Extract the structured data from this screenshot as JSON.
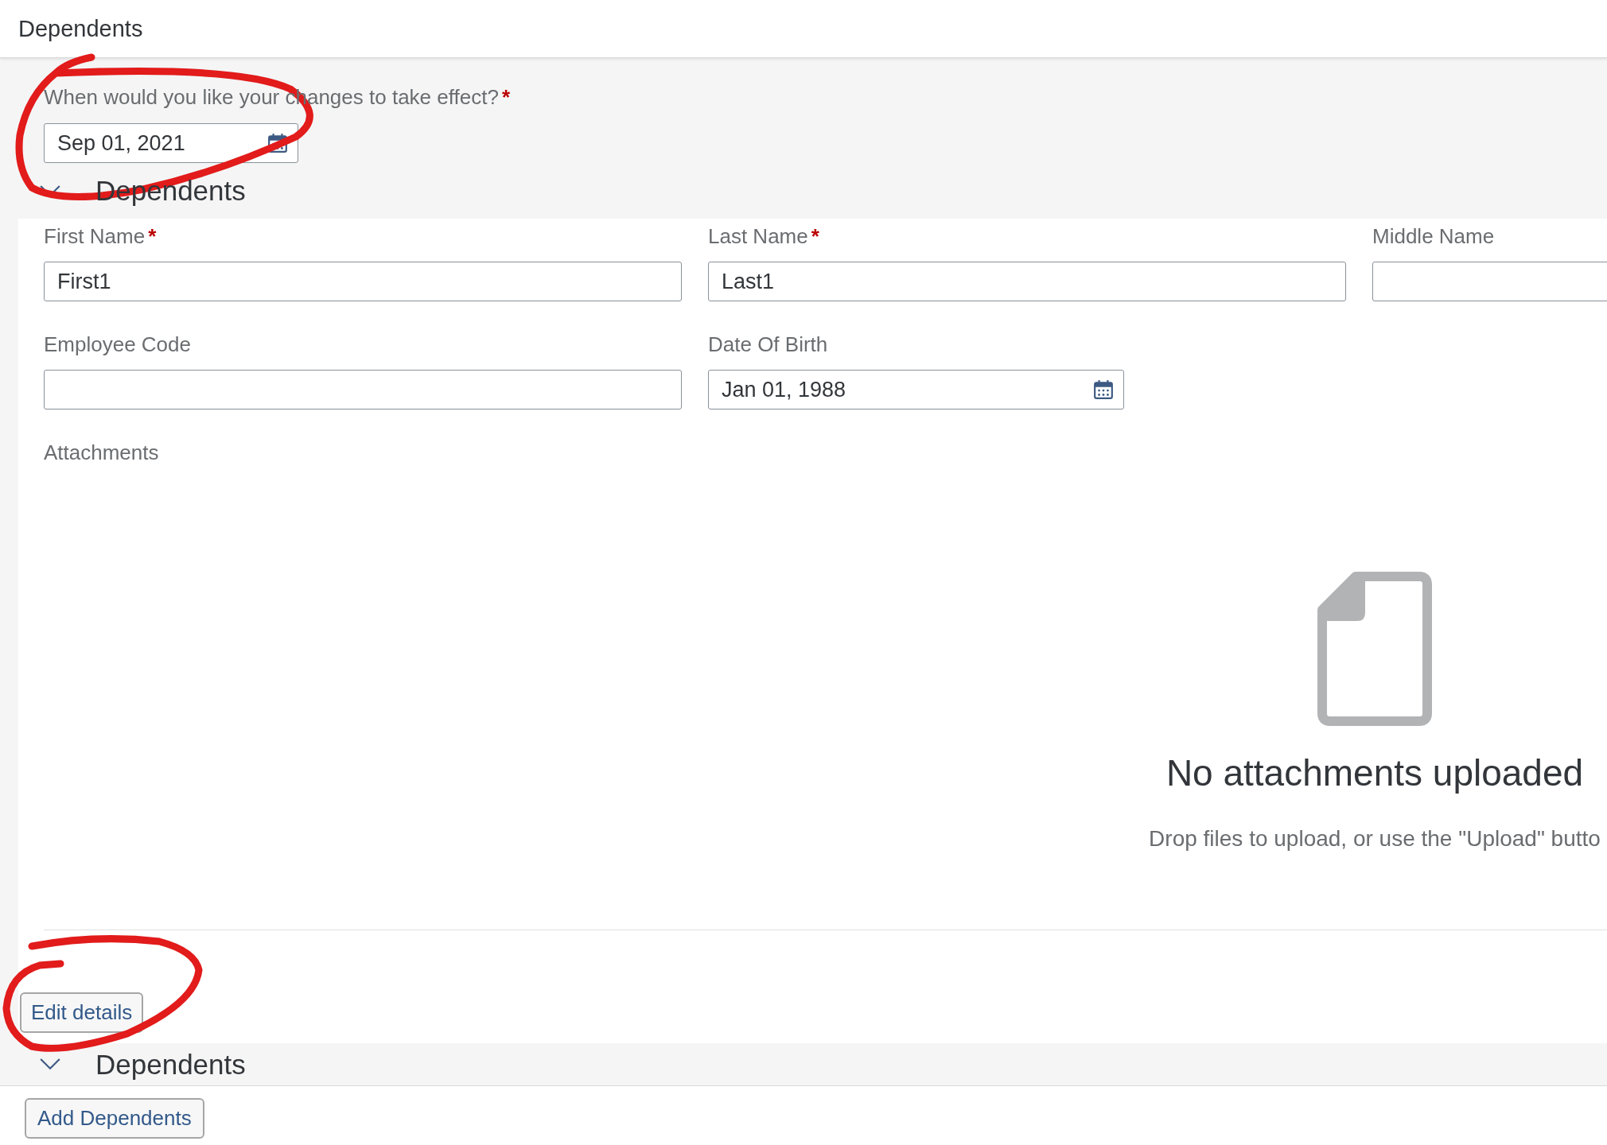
{
  "header": {
    "title": "Dependents"
  },
  "effective_date": {
    "label": "When would you like your changes to take effect?",
    "required_mark": "*",
    "value": "Sep 01, 2021"
  },
  "section": {
    "title": "Dependents",
    "expanded": true
  },
  "fields": [
    {
      "kind": "text",
      "label": "First Name",
      "required_mark": "*",
      "value": "First1"
    },
    {
      "kind": "text",
      "label": "Last Name",
      "required_mark": "*",
      "value": "Last1"
    },
    {
      "kind": "text",
      "label": "Middle Name"
    },
    {
      "kind": "text",
      "label": "Employee Code"
    },
    {
      "kind": "date",
      "label": "Date Of Birth",
      "value": "Jan 01, 1988"
    }
  ],
  "attachments": {
    "label": "Attachments",
    "empty_title": "No attachments uploaded",
    "empty_hint": "Drop files to upload, or use the \"Upload\" butto"
  },
  "edit_button": "Edit details",
  "second_section": {
    "title": "Dependents",
    "expanded": true
  },
  "add_button": "Add Dependents"
}
